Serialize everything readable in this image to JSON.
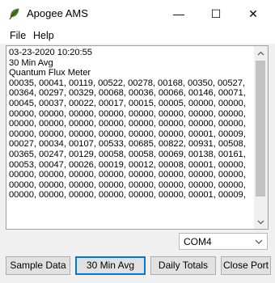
{
  "window": {
    "title": "Apogee AMS",
    "minimize_glyph": "—",
    "maximize_glyph": "☐",
    "close_glyph": "✕"
  },
  "menu": {
    "file": "File",
    "help": "Help"
  },
  "output": {
    "lines": [
      "03-23-2020 10:20:55",
      "30 Min Avg",
      "Quantum Flux Meter",
      "00035, 00041, 00119, 00522, 00278, 00168, 00350, 00527,",
      "00364, 00297, 00329, 00068, 00036, 00066, 00146, 00071,",
      "00045, 00037, 00022, 00017, 00015, 00005, 00000, 00000,",
      "00000, 00000, 00000, 00000, 00000, 00000, 00000, 00000,",
      "00000, 00000, 00000, 00000, 00000, 00000, 00000, 00000,",
      "00000, 00000, 00000, 00000, 00000, 00000, 00001, 00009,",
      "00027, 00034, 00107, 00533, 00685, 00822, 00931, 00508,",
      "00365, 00247, 00129, 00058, 00058, 00069, 00138, 00161,",
      "00053, 00047, 00026, 00019, 00012, 00008, 00001, 00000,",
      "00000, 00000, 00000, 00000, 00000, 00000, 00000, 00000,",
      "00000, 00000, 00000, 00000, 00000, 00000, 00000, 00000,",
      "00000, 00000, 00000, 00000, 00000, 00000, 00001, 00009,"
    ]
  },
  "port_select": {
    "value": "COM4"
  },
  "buttons": {
    "sample_data": "Sample Data",
    "avg_30min": "30 Min Avg",
    "daily_totals": "Daily Totals",
    "close_port": "Close Port"
  },
  "icons": {
    "app": "leaf-icon",
    "scroll_up": "chevron-up-icon",
    "scroll_down": "chevron-down-icon",
    "dropdown": "chevron-down-icon"
  },
  "colors": {
    "focus_border": "#0078d7",
    "button_face": "#e1e1e1",
    "app_icon": "#4a7a2a"
  }
}
